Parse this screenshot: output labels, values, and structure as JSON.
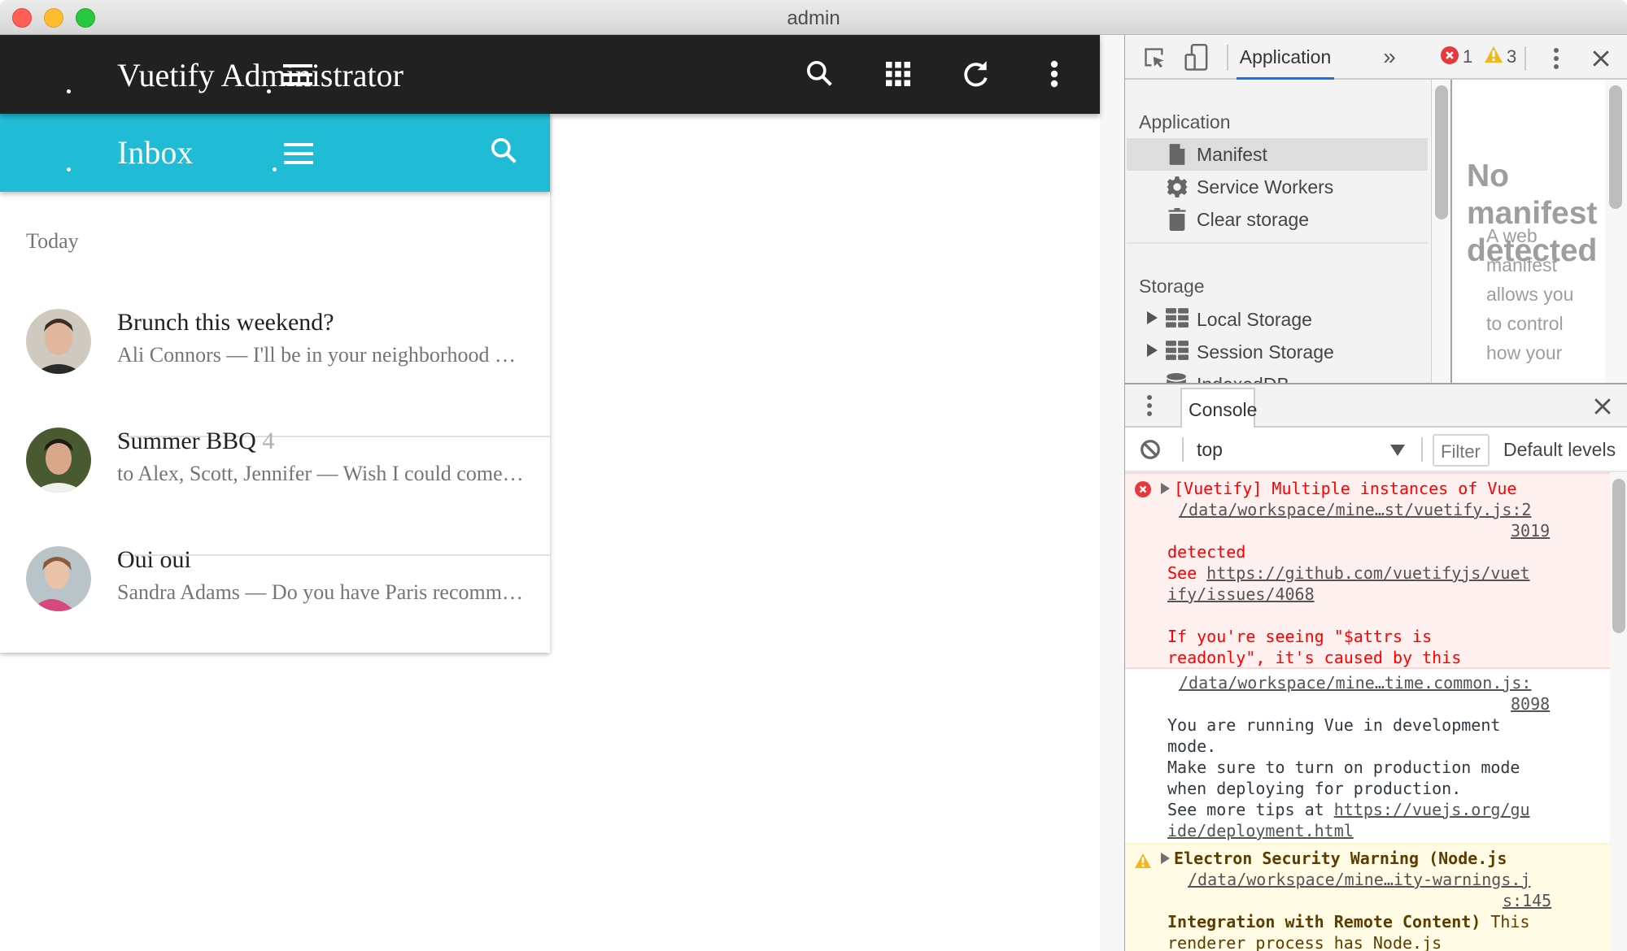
{
  "window": {
    "title": "admin"
  },
  "appbar": {
    "title": "Vuetify Administrator",
    "icons": [
      "menu-icon",
      "search-icon",
      "apps-icon",
      "refresh-icon",
      "more-vert-icon"
    ]
  },
  "inbox": {
    "title": "Inbox",
    "subheader": "Today",
    "items": [
      {
        "title": "Brunch this weekend?",
        "count": "",
        "subtitle": "Ali Connors — I'll be in your neighborhood doing errands this weekend. Do you want to hang out?",
        "avatar_colors": [
          "#c9c3b8",
          "#3a2d26"
        ]
      },
      {
        "title": "Summer BBQ",
        "count": "4",
        "subtitle": "to Alex, Scott, Jennifer — Wish I could come, but I'm out of town this weekend.",
        "avatar_colors": [
          "#4a5a30",
          "#f2f0ec"
        ]
      },
      {
        "title": "Oui oui",
        "count": "",
        "subtitle": "Sandra Adams — Do you have Paris recommendations? Have you ever been?",
        "avatar_colors": [
          "#b9c4c9",
          "#d7497b"
        ]
      }
    ]
  },
  "devtools": {
    "active_tab": "Application",
    "more_tabs": "»",
    "error_count": "1",
    "warning_count": "3",
    "sidebar": {
      "sections": [
        {
          "title": "Application",
          "items": [
            {
              "label": "Manifest",
              "icon": "file-icon",
              "selected": true
            },
            {
              "label": "Service Workers",
              "icon": "gear-icon",
              "selected": false
            },
            {
              "label": "Clear storage",
              "icon": "trash-icon",
              "selected": false
            }
          ]
        },
        {
          "title": "Storage",
          "items": [
            {
              "label": "Local Storage",
              "icon": "table-icon",
              "expandable": true
            },
            {
              "label": "Session Storage",
              "icon": "table-icon",
              "expandable": true
            },
            {
              "label": "IndexedDB",
              "icon": "database-icon",
              "expandable": false
            }
          ]
        }
      ]
    },
    "manifest": {
      "title": "No manifest detected",
      "description": "A web manifest allows you to control how your"
    },
    "drawer": {
      "tab": "Console",
      "context": "top",
      "filter_placeholder": "Filter",
      "levels": "Default levels"
    },
    "console": [
      {
        "level": "error",
        "lines": [
          "[Vuetify] Multiple instances of Vue",
          "detected",
          "See ",
          "If you're seeing \"$attrs is",
          "readonly\", it's caused by this"
        ],
        "source": [
          "/data/workspace/mine…st/vuetify.js:2",
          "3019"
        ],
        "link": [
          "https://github.com/vuetifyjs/vuet",
          "ify/issues/4068"
        ]
      },
      {
        "level": "info",
        "source": [
          "/data/workspace/mine…time.common.js:",
          "8098"
        ],
        "lines": [
          "You are running Vue in development",
          "mode.",
          "Make sure to turn on production mode",
          "when deploying for production.",
          "See more tips at "
        ],
        "link": [
          "https://vuejs.org/gu",
          "ide/deployment.html"
        ]
      },
      {
        "level": "warning",
        "lines": [
          "Electron Security Warning (Node.js",
          "Integration with Remote Content)",
          " This",
          "renderer process has Node.js"
        ],
        "source": [
          "/data/workspace/mine…ity-warnings.j",
          "s:145"
        ]
      }
    ]
  }
}
